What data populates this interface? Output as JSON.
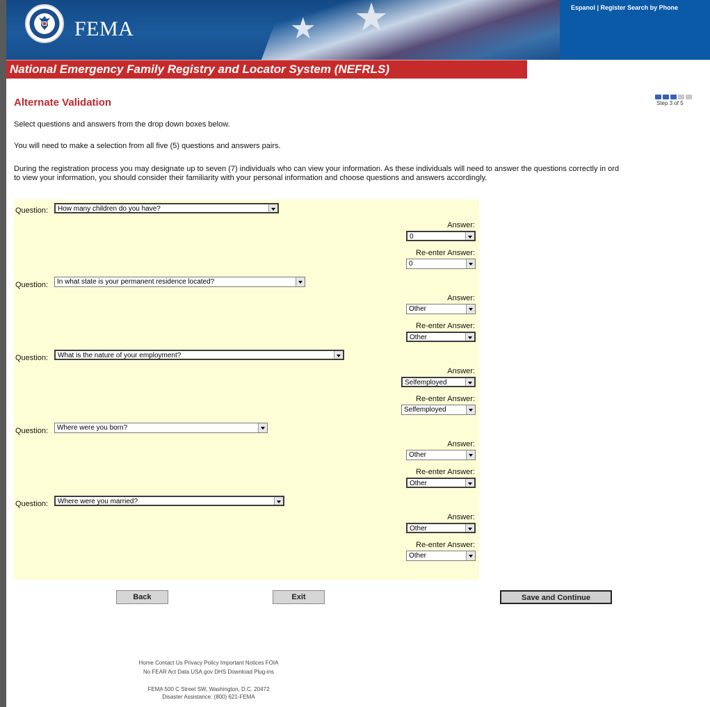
{
  "header": {
    "logo_text": "FEMA",
    "top_links": [
      "Espanol",
      "Register",
      "Search by Phone"
    ],
    "system_title": "National Emergency Family Registry and Locator System (NEFRLS)"
  },
  "page": {
    "title": "Alternate Validation",
    "step_label": "Step 3 of 5",
    "steps_total": 5,
    "steps_completed": 3,
    "instructions": [
      "Select questions and answers from the drop down boxes below.",
      "You will need to make a selection from all five (5) questions and answers pairs.",
      "During the registration process you may designate up to seven (7) individuals who can view your information. As these individuals will need to answer the questions correctly in ord",
      "to view your information, you should consider their familiarity with your personal information and choose questions and answers accordingly."
    ]
  },
  "form": {
    "question_label": "Question:",
    "answer_label": "Answer:",
    "reenter_label": "Re-enter Answer:",
    "pairs": [
      {
        "question": "How many children do you have?",
        "answer": "0",
        "reenter": "0"
      },
      {
        "question": "In what state is your permanent residence located?",
        "answer": "Other",
        "reenter": "Other"
      },
      {
        "question": "What is the nature of your employment?",
        "answer": "Selfemployed",
        "reenter": "Selfemployed"
      },
      {
        "question": "Where were you born?",
        "answer": "Other",
        "reenter": "Other"
      },
      {
        "question": "Where were you married?",
        "answer": "Other",
        "reenter": "Other"
      }
    ]
  },
  "buttons": {
    "back": "Back",
    "exit": "Exit",
    "save_continue": "Save and Continue"
  },
  "footer": {
    "links_line1": "Home Contact Us Privacy Policy Important Notices FOIA",
    "links_line2": "No FEAR Act Data USA.gov DHS Download Plug-ins",
    "address": "FEMA 500 C Street SW, Washington, D.C. 20472",
    "assistance": "Disaster Assistance: (800) 621-FEMA"
  },
  "colors": {
    "banner": "#174f8e",
    "red_bar": "#c62b2b",
    "title_red": "#c0282f",
    "form_bg": "#fefed6",
    "step_on": "#3b5fb8",
    "step_off": "#c8c8c8"
  }
}
